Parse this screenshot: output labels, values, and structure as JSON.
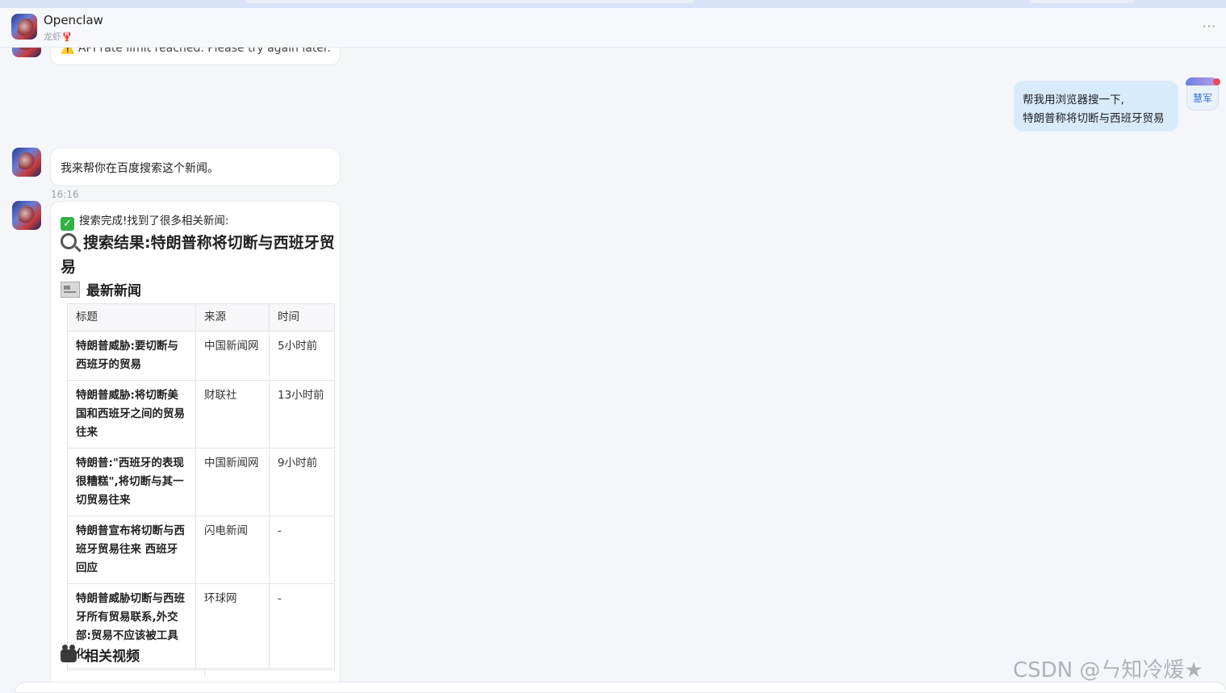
{
  "header": {
    "title": "Openclaw",
    "subtitle": "龙虾🦞",
    "more": "···"
  },
  "messages": {
    "partial_error": "⚠️ API rate limit reached. Please try again later.",
    "user_line1": "帮我用浏览器搜一下,",
    "user_line2": "特朗普称将切断与西班牙贸易",
    "user_name": "慧军",
    "bot_reply1": "我来帮你在百度搜索这个新闻。",
    "time": "16:16",
    "status_text": "搜索完成!找到了很多相关新闻:",
    "search_heading": "搜索结果:特朗普称将切断与西班牙贸易",
    "news_heading": "最新新闻",
    "video_heading": "相关视频"
  },
  "table": {
    "headers": [
      "标题",
      "来源",
      "时间"
    ],
    "rows": [
      {
        "title": "特朗普威胁:要切断与西班牙的贸易",
        "source": "中国新闻网",
        "time": "5小时前"
      },
      {
        "title": "特朗普威胁:将切断美国和西班牙之间的贸易往来",
        "source": "财联社",
        "time": "13小时前"
      },
      {
        "title": "特朗普:\"西班牙的表现很糟糕\",将切断与其一切贸易往来",
        "source": "中国新闻网",
        "time": "9小时前"
      },
      {
        "title": "特朗普宣布将切断与西班牙贸易往来 西班牙回应",
        "source": "闪电新闻",
        "time": "-"
      },
      {
        "title": "特朗普威胁切断与西班牙所有贸易联系,外交部:贸易不应该被工具化",
        "source": "环球网",
        "time": "-"
      }
    ]
  },
  "watermark": "CSDN @ㄣ知冷煖★"
}
